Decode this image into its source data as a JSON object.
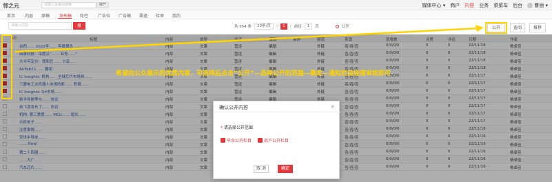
{
  "header": {
    "logo": "邻之元",
    "search_placeholder": "请输入关键词搜索",
    "search_button": "搜产",
    "nav": [
      "媒体中心 ▾",
      "商户",
      "内容",
      "业务",
      "菜菜车",
      "后台"
    ],
    "active_nav": "内容",
    "user_name": "曹丽 ▾"
  },
  "tabs": [
    "首页",
    "内容",
    "原稿",
    "发布稿",
    "轮巴",
    "广告位",
    "广告稿",
    "渠道",
    "待审",
    "我的"
  ],
  "active_tab": "发布稿",
  "filters": {
    "search_placeholder": "请输入内容",
    "search_button": "搜",
    "total": "共 954 条",
    "page_size": "20条/页",
    "page_current": "1",
    "goto_label": "前往",
    "goto_value": "1",
    "page_unit": "页",
    "public_filter": "公开"
  },
  "actions": {
    "public_button": "公开",
    "review_button": "查阅",
    "recommend_button": "推荐"
  },
  "table": {
    "columns": [
      "",
      "标题",
      "内部",
      "类型",
      "阅读",
      "编辑",
      "推荐",
      "频道",
      "来源",
      "观看数",
      "点赞",
      "评论",
      "日期",
      "作者"
    ],
    "rows": [
      {
        "checked": true,
        "title": "台积…… 2022年…… 年度报告……",
        "cat": "内部",
        "type": "文章",
        "src": "营运",
        "editor": "编辑",
        "rec": "",
        "chan": "外链",
        "from": "否/否/否",
        "views": "0/0/0/0",
        "likes": "0",
        "comments": "0",
        "date": "22/11/18",
        "author": "杨卓佳"
      },
      {
        "checked": true,
        "title": "闻泰科技：深度认“…… 业务……”",
        "cat": "内部",
        "type": "文章",
        "src": "营运",
        "editor": "编辑",
        "rec": "",
        "chan": "外链",
        "from": "否/否/否",
        "views": "0/0/0/0",
        "likes": "0",
        "comments": "0",
        "date": "22/11/18",
        "author": "杨卓佳"
      },
      {
        "checked": true,
        "title": "大半年定价：我和任…… 分享……",
        "cat": "内部",
        "type": "文章",
        "src": "营运",
        "editor": "编辑",
        "rec": "",
        "chan": "外链",
        "from": "否/否/否",
        "views": "0/0/0/0",
        "likes": "0",
        "comments": "0",
        "date": "22/11/18",
        "author": "杨卓佳"
      },
      {
        "checked": true,
        "title": "AirFab22…… 要闻",
        "cat": "内部",
        "type": "文章",
        "src": "营运",
        "editor": "编辑",
        "rec": "",
        "chan": "外链",
        "from": "否/否/否",
        "views": "0/0/0/0",
        "likes": "0",
        "comments": "0",
        "date": "22/11/18",
        "author": "杨卓佳"
      },
      {
        "checked": true,
        "title": "IC Insights: 机构…… 全球芯片市场将……",
        "cat": "内部",
        "type": "文章",
        "src": "营运",
        "editor": "编辑",
        "rec": "",
        "chan": "外链",
        "from": "否/否/否",
        "views": "0/0/0/0",
        "likes": "0",
        "comments": "0",
        "date": "22/11/17",
        "author": "杨卓佳"
      },
      {
        "checked": true,
        "title": "三菱电工业机器人市场的新…… 积极……",
        "cat": "内部",
        "type": "文章",
        "src": "营运",
        "editor": "编辑",
        "rec": "",
        "chan": "外链",
        "from": "否/否/否",
        "views": "0/0/0/0",
        "likes": "0",
        "comments": "0",
        "date": "22/11/17",
        "author": "杨卓佳"
      },
      {
        "checked": true,
        "title": "IC Insights: Q4市场……",
        "cat": "内部",
        "type": "文章",
        "src": "营运",
        "editor": "编辑",
        "rec": "",
        "chan": "外链",
        "from": "否/否/否",
        "views": "0/0/0/0",
        "likes": "0",
        "comments": "0",
        "date": "22/11/17",
        "author": "杨卓佳"
      },
      {
        "checked": false,
        "title": "新半导体等与…… 协议",
        "cat": "内部",
        "type": "文章",
        "src": "营运",
        "editor": "编辑",
        "rec": "",
        "chan": "外链",
        "from": "否/否/否",
        "views": "0/0/0/0",
        "likes": "0",
        "comments": "0",
        "date": "22/11/17",
        "author": "杨卓佳"
      },
      {
        "checked": false,
        "title": "英飞凌发布了…… 协议",
        "cat": "内部",
        "type": "文章",
        "src": "营运",
        "editor": "编辑",
        "rec": "",
        "chan": "外链",
        "from": "否/否/否",
        "views": "0/0/0/0",
        "likes": "0",
        "comments": "0",
        "date": "22/11/17",
        "author": "杨卓佳"
      },
      {
        "checked": false,
        "title": "机构: 第三季度…… MCU…… 增长……",
        "cat": "内部",
        "type": "文章",
        "src": "营运",
        "editor": "编辑",
        "rec": "",
        "chan": "外链",
        "from": "否/否/否",
        "views": "0/0/0/0",
        "likes": "0",
        "comments": "0",
        "date": "22/11/17",
        "author": "杨卓佳"
      },
      {
        "checked": false,
        "title": "示机电子……",
        "cat": "内部",
        "type": "文章",
        "src": "营运",
        "editor": "编辑",
        "rec": "",
        "chan": "外链",
        "from": "否/否/否",
        "views": "0/0/0/0",
        "likes": "0",
        "comments": "0",
        "date": "22/11/17",
        "author": "杨卓佳"
      },
      {
        "checked": false,
        "title": "注意事情……",
        "cat": "内部",
        "type": "文章",
        "src": "营运",
        "editor": "编辑",
        "rec": "",
        "chan": "外链",
        "from": "否/否/否",
        "views": "0/0/0/0",
        "likes": "0",
        "comments": "0",
        "date": "22/11/16",
        "author": "杨卓佳"
      },
      {
        "checked": false,
        "title": "安世半导体……",
        "cat": "内部",
        "type": "文章",
        "src": "营运",
        "editor": "编辑",
        "rec": "",
        "chan": "外链",
        "from": "否/否/否",
        "views": "0/0/0/0",
        "likes": "0",
        "comments": "0",
        "date": "22/11/16",
        "author": "杨卓佳"
      },
      {
        "checked": false,
        "title": "…… Now!",
        "cat": "内部",
        "type": "文章",
        "src": "营运",
        "editor": "编辑",
        "rec": "",
        "chan": "外链",
        "from": "否/否/否",
        "views": "0/0/0/0",
        "likes": "0",
        "comments": "0",
        "date": "22/11/16",
        "author": "杨卓佳"
      },
      {
        "checked": false,
        "title": "第二十四届……",
        "cat": "内部",
        "type": "文章",
        "src": "营运",
        "editor": "编辑",
        "rec": "",
        "chan": "外链",
        "from": "否/否/否",
        "views": "0/0/0/0",
        "likes": "0",
        "comments": "0",
        "date": "22/11/16",
        "author": "杨卓佳"
      },
      {
        "checked": false,
        "title": "……大广……",
        "cat": "内部",
        "type": "文章",
        "src": "营运",
        "editor": "编辑",
        "rec": "",
        "chan": "外链",
        "from": "否/否/否",
        "views": "0/0/0/0",
        "likes": "0",
        "comments": "0",
        "date": "22/11/16",
        "author": "杨卓佳"
      },
      {
        "checked": false,
        "title": "汽车芯片……",
        "cat": "内部",
        "type": "文章",
        "src": "营运",
        "editor": "编辑",
        "rec": "",
        "chan": "外链",
        "from": "否/否/否",
        "views": "0/0/0/0",
        "likes": "0",
        "comments": "0",
        "date": "22/11/16",
        "author": "杨卓佳"
      }
    ]
  },
  "annotation": {
    "text": "希望向公众展示的优质内容，可选择后点击“公开”—选择公开的范围—确定—通知栏目经理审核即可",
    "color": "#ffd400"
  },
  "modal": {
    "title": "确认公开内容",
    "close": "×",
    "range_label": "请选择公开范围",
    "required_mark": "*",
    "options": [
      "平台公开栏目",
      "商户公开栏目"
    ],
    "cancel": "取 消",
    "confirm": "确定"
  },
  "colors": {
    "accent": "#e4393c",
    "annotation": "#ffd400"
  }
}
